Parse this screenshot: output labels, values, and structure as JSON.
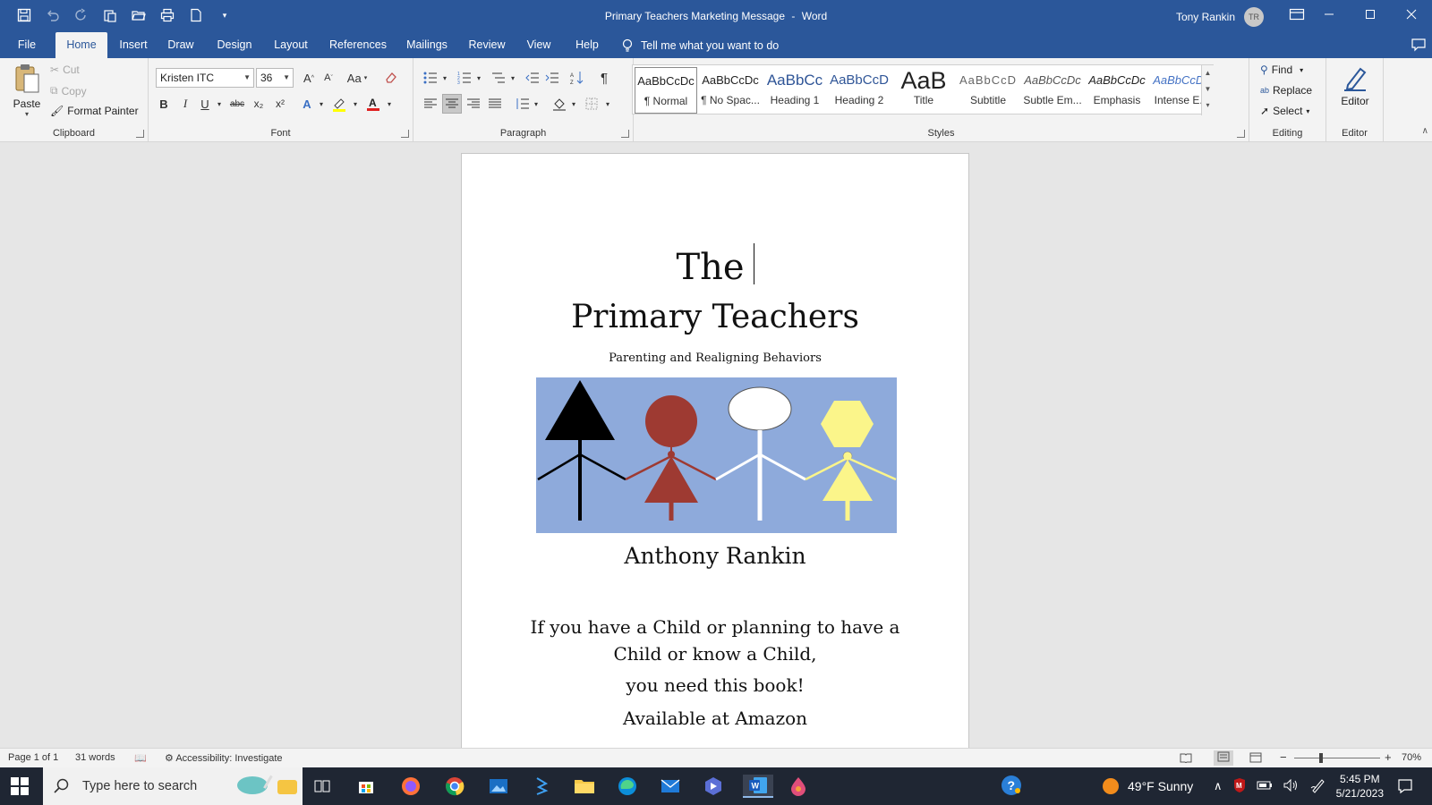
{
  "app": {
    "document_title": "Primary Teachers Marketing Message",
    "separator": "-",
    "app_name": "Word",
    "user_name": "Tony Rankin",
    "user_initials": "TR"
  },
  "tabs": [
    {
      "label": "File"
    },
    {
      "label": "Home"
    },
    {
      "label": "Insert"
    },
    {
      "label": "Draw"
    },
    {
      "label": "Design"
    },
    {
      "label": "Layout"
    },
    {
      "label": "References"
    },
    {
      "label": "Mailings"
    },
    {
      "label": "Review"
    },
    {
      "label": "View"
    },
    {
      "label": "Help"
    }
  ],
  "tell_me": "Tell me what you want to do",
  "clipboard": {
    "label": "Clipboard",
    "paste": "Paste",
    "cut": "Cut",
    "copy": "Copy",
    "format_painter": "Format Painter"
  },
  "font": {
    "label": "Font",
    "font_name": "Kristen ITC",
    "font_size": "36",
    "bold": "B",
    "italic": "I",
    "underline": "U",
    "strikethrough": "abc",
    "subscript": "x₂",
    "superscript": "x²",
    "change_case": "Aa"
  },
  "paragraph": {
    "label": "Paragraph"
  },
  "styles": {
    "label": "Styles",
    "items": [
      {
        "sample": "AaBbCcDc",
        "name": "¶ Normal"
      },
      {
        "sample": "AaBbCcDc",
        "name": "¶ No Spac..."
      },
      {
        "sample": "AaBbCc",
        "name": "Heading 1"
      },
      {
        "sample": "AaBbCcD",
        "name": "Heading 2"
      },
      {
        "sample": "AaB",
        "name": "Title"
      },
      {
        "sample": "AaBbCcD",
        "name": "Subtitle"
      },
      {
        "sample": "AaBbCcDc",
        "name": "Subtle Em..."
      },
      {
        "sample": "AaBbCcDc",
        "name": "Emphasis"
      },
      {
        "sample": "AaBbCcDc",
        "name": "Intense E..."
      }
    ]
  },
  "editing": {
    "label": "Editing",
    "find": "Find",
    "replace": "Replace",
    "select": "Select"
  },
  "editor": {
    "label": "Editor",
    "button": "Editor"
  },
  "document": {
    "line1": "The",
    "line2": "Primary Teachers",
    "subtitle": "Parenting and Realigning Behaviors",
    "author": "Anthony Rankin",
    "body1a": "If you have a Child or planning to have a",
    "body1b": "Child or know a Child,",
    "body2": "you need this book!",
    "body3": "Available at Amazon"
  },
  "statusbar": {
    "page": "Page 1 of 1",
    "words": "31 words",
    "accessibility": "Accessibility: Investigate",
    "zoom": "70%",
    "zoom_minus": "−",
    "zoom_plus": "+"
  },
  "taskbar": {
    "search_placeholder": "Type here to search",
    "weather": "49°F  Sunny",
    "time": "5:45 PM",
    "date": "5/21/2023"
  },
  "colors": {
    "word_blue": "#2b579a",
    "image_bg": "#8eaadb",
    "figure_red": "#9e3a32",
    "figure_yellow": "#fbf58a"
  }
}
